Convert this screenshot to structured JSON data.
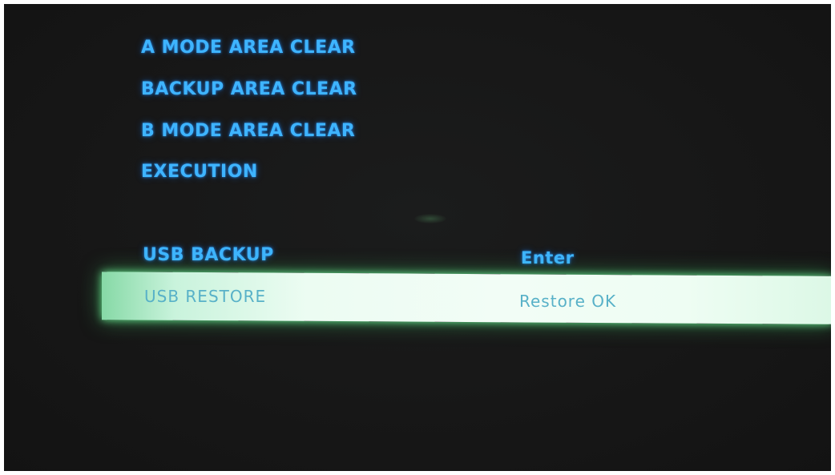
{
  "menu": {
    "items": [
      {
        "label": "A MODE AREA CLEAR"
      },
      {
        "label": "BACKUP AREA CLEAR"
      },
      {
        "label": "B MODE AREA CLEAR"
      },
      {
        "label": "EXECUTION"
      },
      {
        "label": "USB BACKUP",
        "value": "Enter"
      },
      {
        "label": "USB RESTORE",
        "value": "Restore OK",
        "selected": true
      }
    ]
  },
  "colors": {
    "background": "#171717",
    "text": "#3eb4ff",
    "highlight": "#eefdf3",
    "highlight_text": "#58b1c8"
  }
}
